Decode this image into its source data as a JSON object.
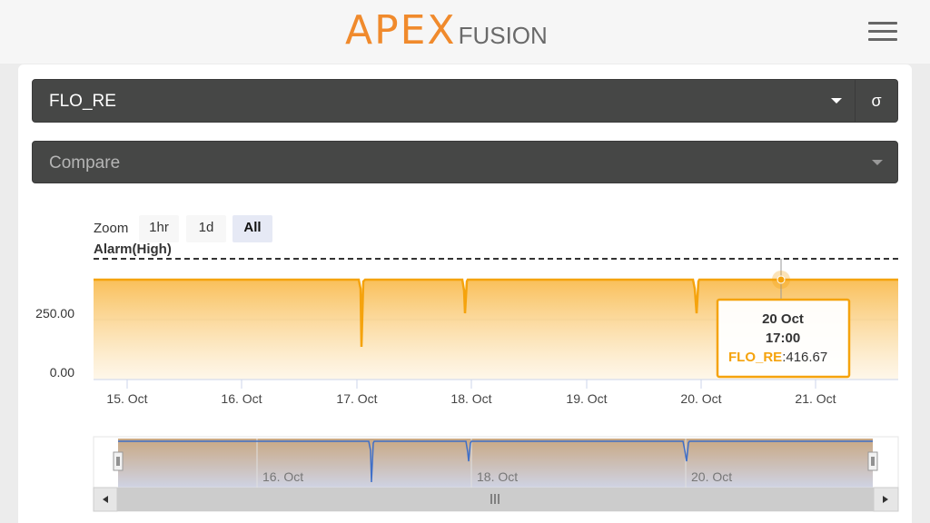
{
  "header": {
    "logo_main": "APEX",
    "logo_sub": "FUSION"
  },
  "probe_select": {
    "value": "FLO_RE",
    "sigma_label": "σ"
  },
  "compare_select": {
    "placeholder": "Compare"
  },
  "zoom": {
    "label": "Zoom",
    "buttons": [
      "1hr",
      "1d",
      "All"
    ],
    "active": "All"
  },
  "chart_data": {
    "type": "area",
    "series": [
      {
        "name": "FLO_RE",
        "x": [
          "15. Oct",
          "16. Oct",
          "17. Oct",
          "18. Oct",
          "19. Oct",
          "20. Oct",
          "21. Oct"
        ],
        "values_desc": "approx constant ~416.67 with brief dips near 17 Oct (~145), 18 Oct (~310) and 20 Oct (~300)",
        "baseline": 416.67,
        "dips": [
          {
            "x": "17. Oct",
            "value": 145
          },
          {
            "x": "18. Oct",
            "value": 310
          },
          {
            "x": "20. Oct",
            "value": 300
          }
        ]
      }
    ],
    "plotline_label": "Alarm(High)",
    "y_ticks": [
      "250.00",
      "0.00"
    ],
    "x_ticks": [
      "15. Oct",
      "16. Oct",
      "17. Oct",
      "18. Oct",
      "19. Oct",
      "20. Oct",
      "21. Oct"
    ],
    "navigator_ticks": [
      "16. Oct",
      "18. Oct",
      "20. Oct"
    ],
    "color": "#f5a30d",
    "tooltip": {
      "date": "20 Oct",
      "time": "17:00",
      "series": "FLO_RE",
      "separator": ":",
      "value": "416.67"
    }
  },
  "colors": {
    "accent": "#f08a2c",
    "series": "#f5a30d",
    "navigator_line": "#3f6fc8",
    "select_bg": "#464746"
  }
}
